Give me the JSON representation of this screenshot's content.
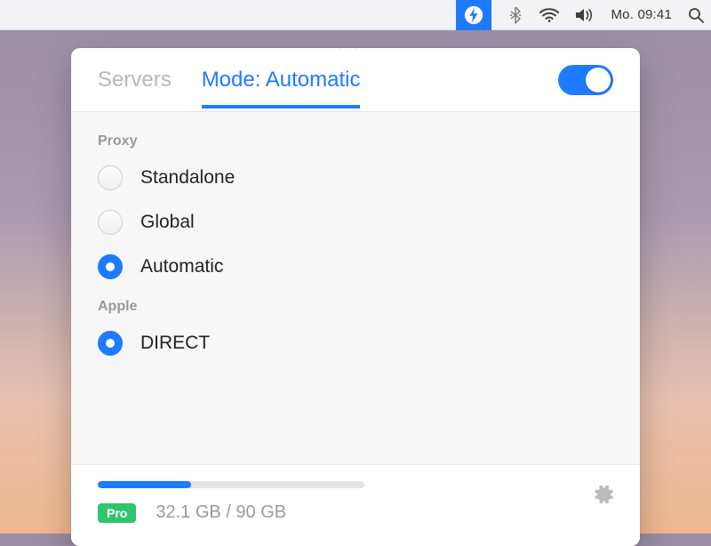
{
  "menubar": {
    "clock": "Mo. 09:41"
  },
  "tabs": {
    "servers": "Servers",
    "mode": "Mode: Automatic"
  },
  "toggle": {
    "on": true
  },
  "sections": {
    "proxy": {
      "title": "Proxy",
      "options": [
        {
          "label": "Standalone",
          "selected": false
        },
        {
          "label": "Global",
          "selected": false
        },
        {
          "label": "Automatic",
          "selected": true
        }
      ]
    },
    "apple": {
      "title": "Apple",
      "options": [
        {
          "label": "DIRECT",
          "selected": true
        }
      ]
    }
  },
  "footer": {
    "pro_label": "Pro",
    "usage_text": "32.1 GB / 90 GB",
    "progress_percent": 35
  },
  "colors": {
    "accent": "#1e7bff",
    "green": "#2ec56b"
  }
}
